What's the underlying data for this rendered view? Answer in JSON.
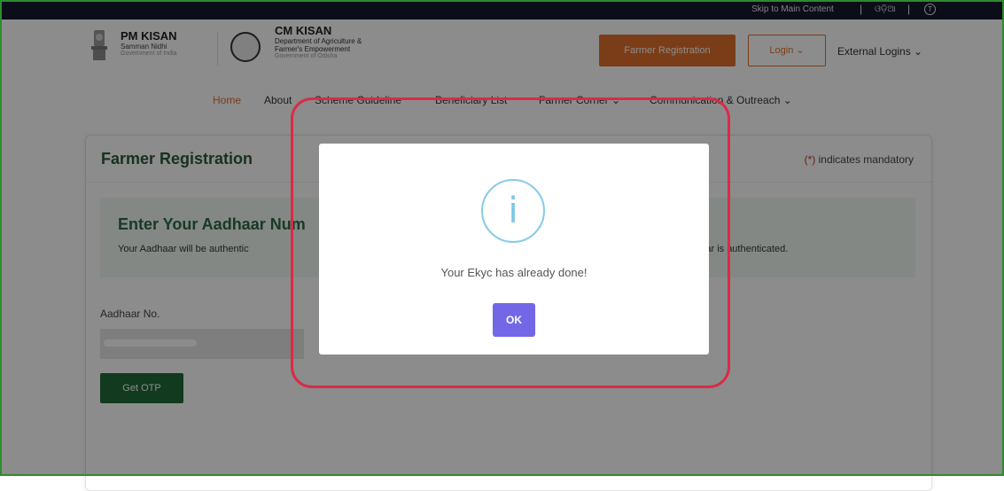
{
  "topbar": {
    "skip_label": "Skip to Main Content",
    "separator": "|",
    "language_label": "ଓଡ଼ିଆ",
    "accessibility_icon": "font-size-icon"
  },
  "header": {
    "pm_kisan_title": "PM KISAN",
    "pm_kisan_subtitle": "Samman Nidhi",
    "pm_kisan_gov": "Government of India",
    "cm_kisan_title": "CM KISAN",
    "cm_kisan_dept_line1": "Department of Agriculture &",
    "cm_kisan_dept_line2": "Farmer's Empowerment",
    "cm_kisan_gov": "Government of Odisha",
    "farmer_registration_button": "Farmer Registration",
    "login_button": "Login ⌄",
    "external_logins": "External Logins ⌄"
  },
  "nav": {
    "items": [
      "Home",
      "About",
      "Scheme Guideline",
      "Beneficiary List",
      "Farmer Corner ⌄",
      "Communication & Outreach ⌄"
    ]
  },
  "card": {
    "title": "Farmer Registration",
    "mandatory_star": "(*)",
    "mandatory_text": " indicates mandatory",
    "aadhaar_heading": "Enter Your Aadhaar Num",
    "aadhaar_desc_left": "Your Aadhaar will be authentic",
    "aadhaar_desc_right": "dhaar is authenticated.",
    "aadhaar_label": "Aadhaar No.",
    "get_otp_button": "Get OTP"
  },
  "modal": {
    "icon_glyph": "i",
    "message": "Your Ekyc has already done!",
    "ok_button": "OK"
  },
  "colors": {
    "orange": "#e0702b",
    "green": "#1f6b3a",
    "modal_button": "#7367e8",
    "highlight": "#d92b46",
    "info": "#87cbe7"
  }
}
